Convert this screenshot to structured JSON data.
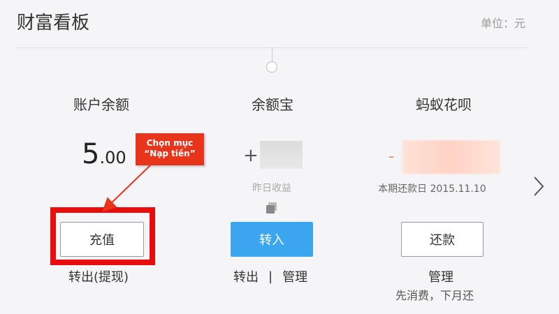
{
  "header": {
    "title": "财富看板",
    "unit": "单位：元"
  },
  "account": {
    "title": "账户余额",
    "balance_int": "5",
    "balance_dec": ".00",
    "recharge_label": "充值",
    "withdraw_label": "转出(提现)"
  },
  "yuebao": {
    "title": "余额宝",
    "sign": "+",
    "yesterday_label": "昨日收益",
    "transfer_in_label": "转入",
    "transfer_out_label": "转出",
    "separator": "|",
    "manage_label": "管理"
  },
  "huabei": {
    "title": "蚂蚁花呗",
    "sign": "-",
    "due_label": "本期还款日 2015.11.10",
    "repay_label": "还款",
    "manage_label": "管理",
    "hint": "先消费，下月还"
  },
  "annotation": {
    "line1": "Chọn mục",
    "line2": "“Nạp tiền”"
  },
  "colors": {
    "accent_blue": "#3ba6ef",
    "annotation_red": "#e80c0c",
    "callout_red": "#e8341a",
    "debt_orange": "#f08060"
  },
  "icons": {
    "copy": "copy-icon",
    "next": "chevron-right-icon"
  }
}
